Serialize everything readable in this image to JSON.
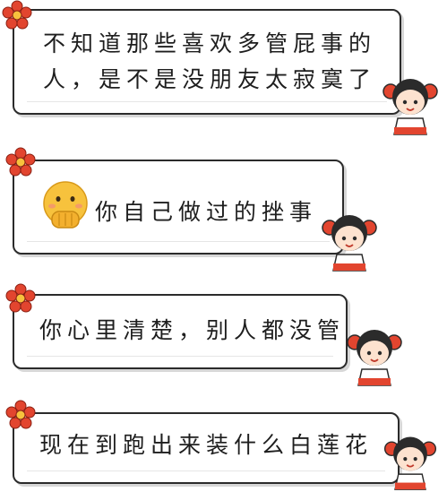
{
  "messages": [
    {
      "lines": [
        "不知道那些喜欢多管屁事的",
        "人，是不是没朋友太寂寞了"
      ]
    },
    {
      "lines": [
        "你自己做过的挫事"
      ]
    },
    {
      "lines": [
        "你心里清楚，别人都没管"
      ]
    },
    {
      "lines": [
        "现在到跑出来装什么白莲花"
      ]
    }
  ],
  "icons": {
    "flower": "red-flower-icon",
    "girl": "cartoon-girl-sticker",
    "emoji": "hand-over-mouth-emoji"
  },
  "colors": {
    "border": "#2b2b2b",
    "flower": "#e2452f",
    "emoji": "#f7c23d"
  }
}
